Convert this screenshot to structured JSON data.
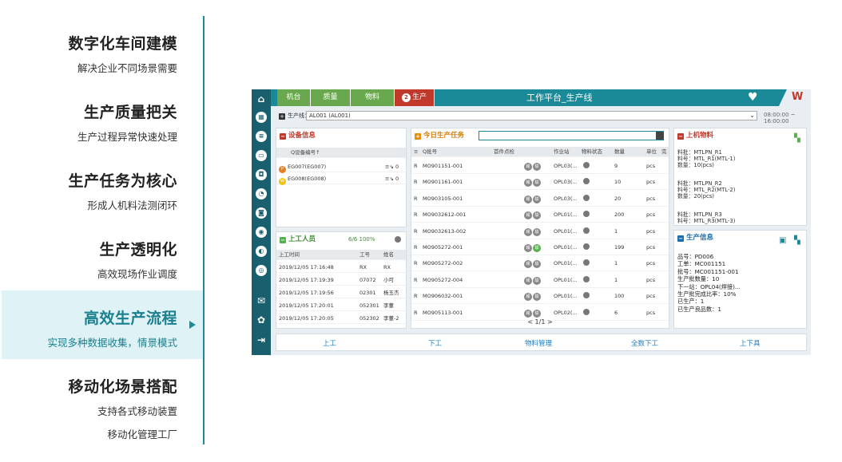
{
  "menu": {
    "items": [
      {
        "title": "数字化车间建模",
        "sub": "解决企业不同场景需要"
      },
      {
        "title": "生产质量把关",
        "sub": "生产过程异常快速处理"
      },
      {
        "title": "生产任务为核心",
        "sub": "形成人机料法测闭环"
      },
      {
        "title": "生产透明化",
        "sub": "高效现场作业调度"
      },
      {
        "title": "高效生产流程",
        "sub": "实现多种数据收集，情景模式"
      },
      {
        "title": "移动化场景搭配",
        "sub": "支持各式移动装置",
        "sub2": "移动化管理工厂"
      }
    ],
    "active_index": 4
  },
  "app": {
    "tabs": [
      "机台",
      "质量",
      "物料",
      "生产"
    ],
    "active_tab_badge": "2",
    "title": "工作平台_生产线",
    "brand_glyph": "W",
    "line_label": "生产线：",
    "line_value": "AL001 (AL001)",
    "time_range": "08:00:00 ~ 16:00:00",
    "equipment": {
      "title": "设备信息",
      "col": "Q设备编号↑",
      "rows": [
        {
          "name": "EG007(EG007)",
          "val": "0"
        },
        {
          "name": "EG008(EG008)",
          "val": "0"
        }
      ]
    },
    "workers": {
      "title": "上工人员",
      "count": "6/6 100%",
      "cols": [
        "上工时间",
        "工号",
        "姓名"
      ],
      "rows": [
        [
          "2019/12/05 17:16:48",
          "RX",
          "RX"
        ],
        [
          "2019/12/05 17:19:39",
          "07072",
          "小可"
        ],
        [
          "2019/12/05 17:19:56",
          "02301",
          "杨玉杰"
        ],
        [
          "2019/12/05 17:20:01",
          "052301",
          "李董"
        ],
        [
          "2019/12/05 17:20:05",
          "052302",
          "李董-2"
        ]
      ]
    },
    "tasks": {
      "title": "今日生产任务",
      "cols": [
        "Q批号",
        "首件点检",
        "作业站",
        "物料状态",
        "数量",
        "单位",
        "完"
      ],
      "rows": [
        [
          "MO901151-001",
          "OPL03(...",
          "9",
          "pcs"
        ],
        [
          "MO901161-001",
          "OPL03(...",
          "10",
          "pcs"
        ],
        [
          "MO903105-001",
          "OPL03(...",
          "20",
          "pcs"
        ],
        [
          "MO9032612-001",
          "OPL01(...",
          "200",
          "pcs"
        ],
        [
          "MO9032613-002",
          "OPL01(...",
          "1",
          "pcs"
        ],
        [
          "MO905272-001",
          "OPL01(...",
          "199",
          "pcs"
        ],
        [
          "MO905272-002",
          "OPL01(...",
          "1",
          "pcs"
        ],
        [
          "MO905272-004",
          "OPL01(...",
          "1",
          "pcs"
        ],
        [
          "MO906032-001",
          "OPL01(...",
          "100",
          "pcs"
        ],
        [
          "MO905113-001",
          "OPL02(...",
          "6",
          "pcs"
        ]
      ],
      "pager": "< 1/1 >"
    },
    "materials": {
      "title": "上机物料",
      "groups": [
        [
          "料批：MTLPN_R1",
          "料号：MTL_R1(MTL-1)",
          "数量：10(pcs)"
        ],
        [
          "料批：MTLPN_R2",
          "料号：MTL_R2(MTL-2)",
          "数量：20(pcs)"
        ],
        [
          "料批：MTLPN_R3",
          "料号：MTL_R3(MTL-3)"
        ]
      ]
    },
    "production": {
      "title": "生产信息",
      "lines": [
        "品号：PD006",
        "工单：MC001151",
        "批号：MC001151-001",
        "生产批数量：10",
        "下一站：OPL04(焊接)...",
        "生产批完成比率：10%",
        "已生产：1",
        "已生产良品数：1"
      ]
    },
    "actions": [
      "上工",
      "下工",
      "物料管理",
      "全数下工",
      "上下具"
    ],
    "colors": {
      "teal": "#1b8a98",
      "dark": "#1a5f6d",
      "green": "#6aa84f",
      "red": "#c0392b",
      "orange": "#e68a00"
    }
  }
}
